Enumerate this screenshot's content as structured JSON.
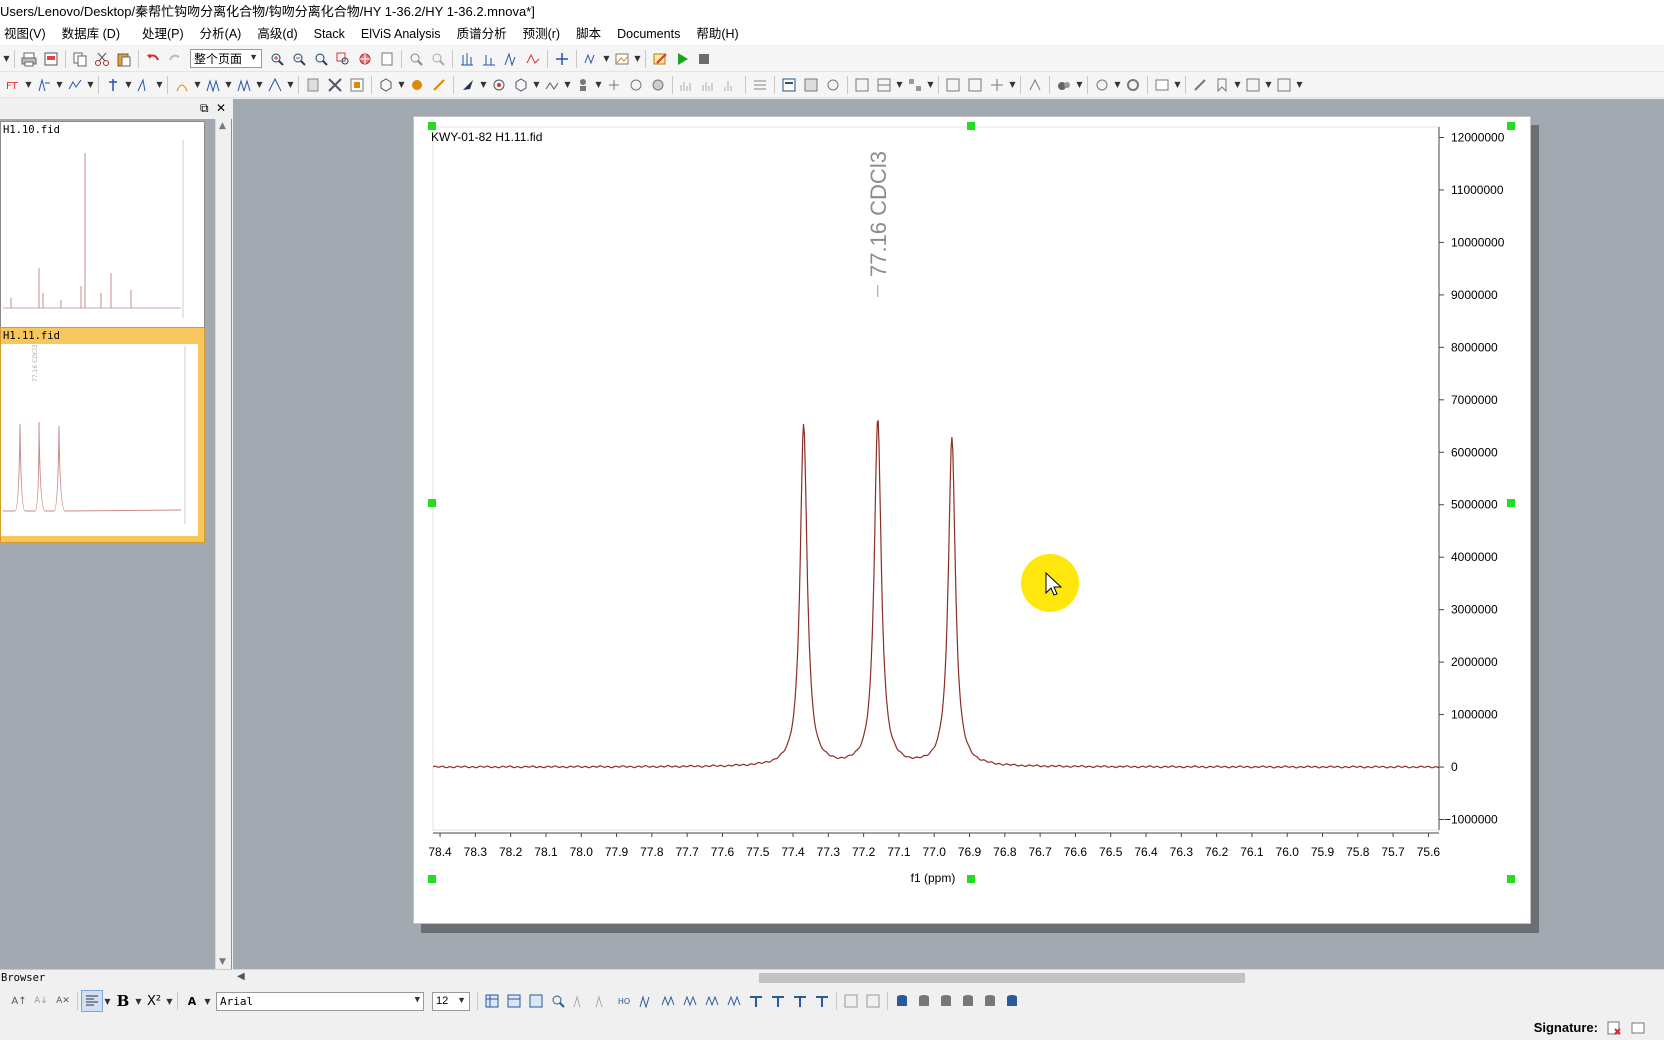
{
  "window": {
    "title": "Users/Lenovo/Desktop/秦帮忙钩吻分离化合物/钩吻分离化合物/HY 1-36.2/HY 1-36.2.mnova*]"
  },
  "menu": [
    "视图(V)",
    "数据库 (D)",
    "处理(P)",
    "分析(A)",
    "高级(d)",
    "Stack",
    "ElViS Analysis",
    "质谱分析",
    "预测(r)",
    "脚本",
    "Documents",
    "帮助(H)"
  ],
  "toolbar": {
    "zoom_select": "整个页面"
  },
  "left_panel": {
    "thumbnails": [
      {
        "label": "H1.10.fid",
        "selected": false
      },
      {
        "label": "H1.11.fid",
        "selected": true,
        "annotation": "77.16 CDCl3"
      }
    ],
    "browser_tab": "Browser"
  },
  "spectrum": {
    "title": "KWY-01-82 H1.11.fid",
    "peak_label": "77.16 CDCl3",
    "xlabel": "f1 (ppm)",
    "line_color": "#8a2f25"
  },
  "chart_data": {
    "type": "line",
    "title": "KWY-01-82 H1.11.fid",
    "xlabel": "f1 (ppm)",
    "ylabel": "",
    "x_reversed": true,
    "xlim": [
      78.42,
      75.57
    ],
    "ylim": [
      -1200000,
      12200000
    ],
    "x_ticks": [
      "78.4",
      "78.3",
      "78.2",
      "78.1",
      "78.0",
      "77.9",
      "77.8",
      "77.7",
      "77.6",
      "77.5",
      "77.4",
      "77.3",
      "77.2",
      "77.1",
      "77.0",
      "76.9",
      "76.8",
      "76.7",
      "76.6",
      "76.5",
      "76.4",
      "76.3",
      "76.2",
      "76.1",
      "76.0",
      "75.9",
      "75.8",
      "75.7",
      "75.6"
    ],
    "y_ticks": [
      "12000000",
      "11000000",
      "10000000",
      "9000000",
      "8000000",
      "7000000",
      "6000000",
      "5000000",
      "4000000",
      "3000000",
      "2000000",
      "1000000",
      "0",
      "-1000000"
    ],
    "peaks": [
      {
        "ppm": 77.37,
        "intensity": 6500000
      },
      {
        "ppm": 77.16,
        "intensity": 6600000
      },
      {
        "ppm": 76.95,
        "intensity": 6270000
      }
    ],
    "grid": false,
    "legend": "none"
  },
  "format_bar": {
    "font": "Arial",
    "size": "12"
  },
  "status": {
    "signature_label": "Signature:"
  },
  "colors": {
    "handle": "#22dd22",
    "cursor_highlight": "#ffe600",
    "selected_thumb": "#f7c65c"
  }
}
